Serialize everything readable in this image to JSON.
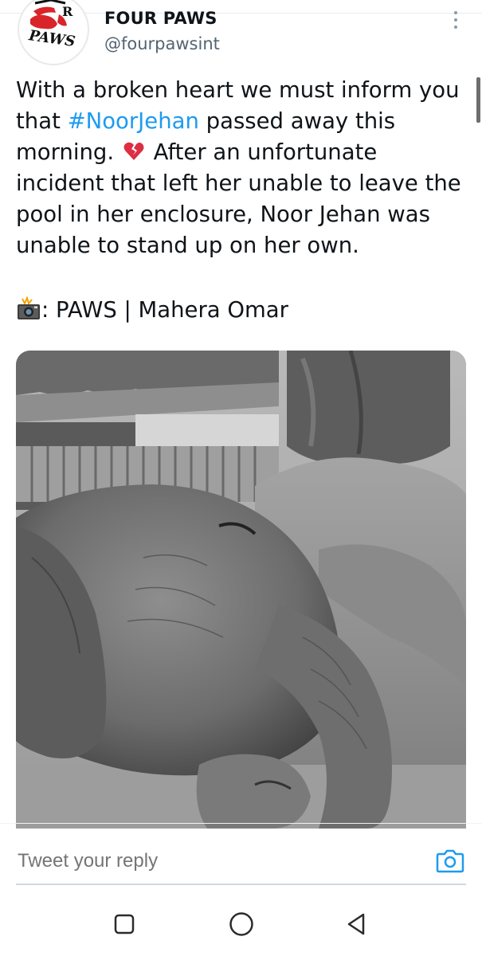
{
  "tweet": {
    "author": {
      "display_name": "FOUR PAWS",
      "handle": "@fourpawsint",
      "avatar_logo_text": "FOUR PAWS"
    },
    "text": {
      "part1": "With a broken heart we must inform you that ",
      "hashtag": "#NoorJehan",
      "part2": " passed away this morning. ",
      "emoji": "broken-heart-icon",
      "part3": " After an unfortunate incident that left her unable to leave the pool in her enclosure, Noor Jehan was unable to stand up on her own."
    },
    "credit": {
      "emoji": "camera-with-flash-icon",
      "text": ": PAWS | Mahera Omar"
    }
  },
  "reply": {
    "placeholder": "Tweet your reply",
    "camera_icon": "camera-icon"
  },
  "navigation": {
    "icons": [
      "recents-square-icon",
      "home-circle-icon",
      "back-triangle-icon"
    ]
  },
  "colors": {
    "hashtag": "#1d9bf0",
    "secondary_text": "#536471",
    "camera_accent": "#1d9bf0",
    "logo_red": "#d9252a"
  }
}
